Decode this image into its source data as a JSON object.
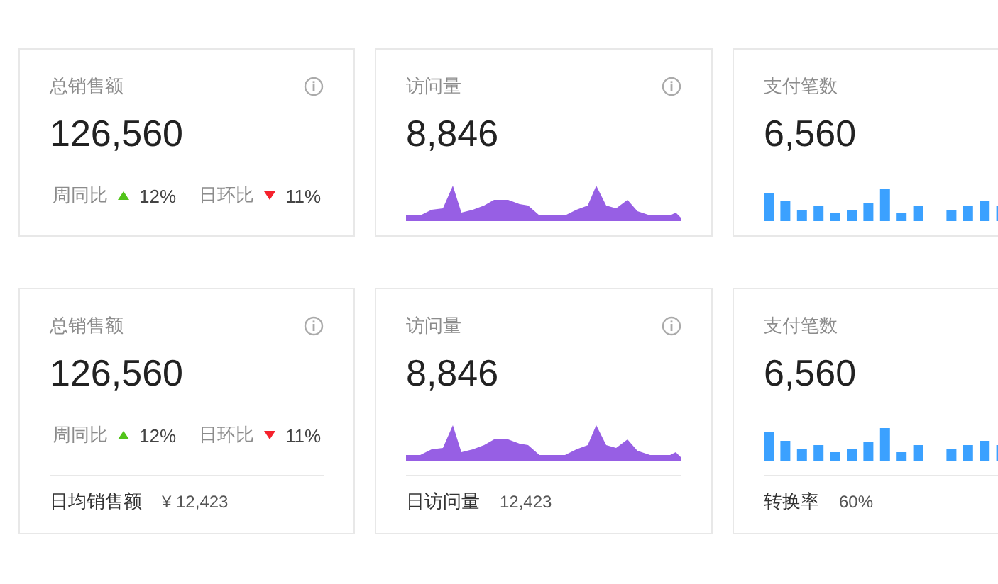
{
  "rows": [
    {
      "cards": [
        {
          "kind": "plain",
          "title": "总销售额",
          "info_icon": true,
          "value": "126,560",
          "trends": [
            {
              "kind": "up",
              "label": "周同比",
              "value": "12%"
            },
            {
              "kind": "down",
              "label": "日环比",
              "value": "11%"
            }
          ]
        },
        {
          "kind": "area",
          "title": "访问量",
          "info_icon": true,
          "value": "8,846"
        },
        {
          "kind": "bar",
          "title": "支付笔数",
          "info_icon": false,
          "value": "6,560"
        }
      ]
    },
    {
      "cards": [
        {
          "kind": "plain",
          "title": "总销售额",
          "info_icon": true,
          "value": "126,560",
          "trends": [
            {
              "kind": "up",
              "label": "周同比",
              "value": "12%"
            },
            {
              "kind": "down",
              "label": "日环比",
              "value": "11%"
            }
          ],
          "footer": {
            "label": "日均销售额",
            "value": "¥ 12,423"
          }
        },
        {
          "kind": "area",
          "title": "访问量",
          "info_icon": true,
          "value": "8,846",
          "footer": {
            "label": "日访问量",
            "value": "12,423"
          }
        },
        {
          "kind": "bar",
          "title": "支付笔数",
          "info_icon": false,
          "value": "6,560",
          "footer": {
            "label": "转换率",
            "value": "60%"
          }
        }
      ]
    }
  ]
}
